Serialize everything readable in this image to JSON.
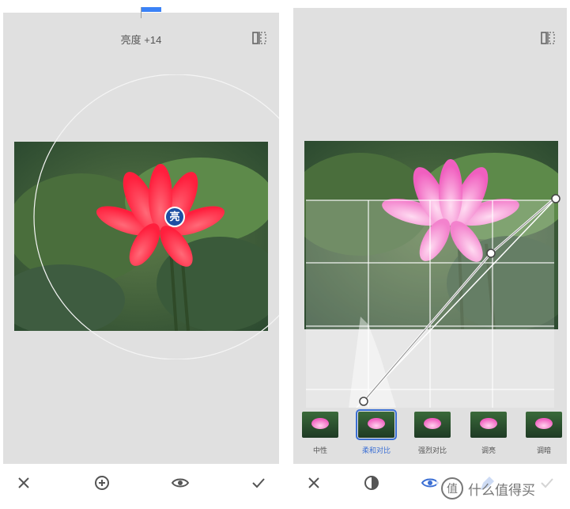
{
  "left_panel": {
    "adjustment_label": "亮度 +14",
    "marker_label": "亮"
  },
  "right_panel": {
    "styles": [
      {
        "label": "中性",
        "selected": false
      },
      {
        "label": "柔和对比",
        "selected": true
      },
      {
        "label": "强烈对比",
        "selected": false
      },
      {
        "label": "调亮",
        "selected": false
      },
      {
        "label": "调暗",
        "selected": false
      }
    ]
  },
  "toolbar": {
    "left": [
      "close-icon",
      "add-circle-icon",
      "eye-icon",
      "check-icon"
    ],
    "right": [
      "close-icon",
      "tone-dial-icon",
      "eye-icon",
      "brush-icon",
      "check-icon"
    ]
  },
  "watermark": {
    "text": "什么值得买"
  },
  "colors": {
    "accent": "#3b6fd4",
    "panel_bg": "#e0e0e0"
  }
}
